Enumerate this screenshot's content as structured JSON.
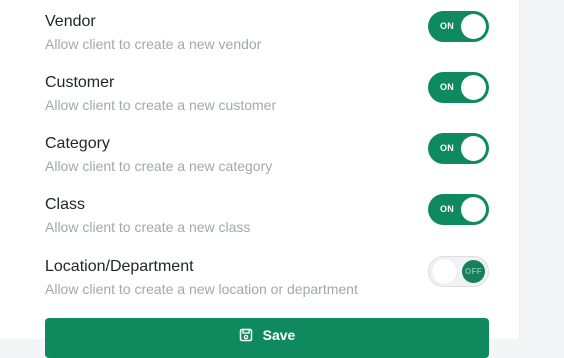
{
  "settings": [
    {
      "title": "Vendor",
      "description": "Allow client to create a new vendor",
      "state": "on",
      "toggle_label": "ON"
    },
    {
      "title": "Customer",
      "description": "Allow client to create a new customer",
      "state": "on",
      "toggle_label": "ON"
    },
    {
      "title": "Category",
      "description": "Allow client to create a new category",
      "state": "on",
      "toggle_label": "ON"
    },
    {
      "title": "Class",
      "description": "Allow client to create a new class",
      "state": "on",
      "toggle_label": "ON"
    },
    {
      "title": "Location/Department",
      "description": "Allow client to create a new location or department",
      "state": "off",
      "toggle_label": "OFF"
    }
  ],
  "save_button": {
    "label": "Save",
    "icon": "save-icon"
  },
  "colors": {
    "accent": "#0f8a5f",
    "text": "#22262a",
    "muted": "#a3a7ad"
  }
}
